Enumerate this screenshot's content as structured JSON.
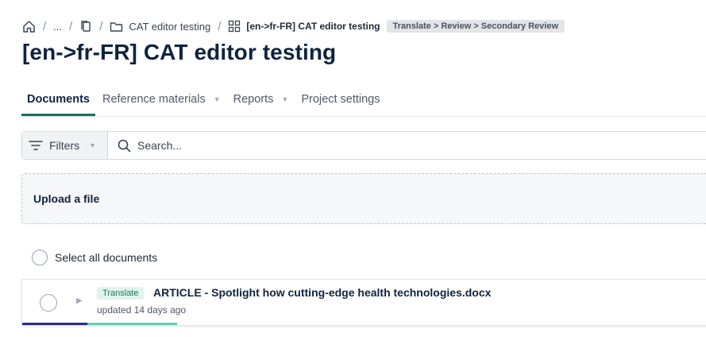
{
  "breadcrumb": {
    "ellipsis": "...",
    "separator": "/",
    "project": "CAT editor testing",
    "current": "[en->fr-FR] CAT editor testing",
    "workflow": "Translate > Review > Secondary Review"
  },
  "page": {
    "title": "[en->fr-FR] CAT editor testing"
  },
  "tabs": [
    {
      "label": "Documents",
      "active": true
    },
    {
      "label": "Reference materials",
      "has_dropdown": true
    },
    {
      "label": "Reports",
      "has_dropdown": true
    },
    {
      "label": "Project settings"
    }
  ],
  "filters": {
    "label": "Filters"
  },
  "search": {
    "placeholder": "Search...",
    "value": ""
  },
  "upload": {
    "label": "Upload a file"
  },
  "select_all": {
    "label": "Select all documents"
  },
  "documents": [
    {
      "status": "Translate",
      "name": "ARTICLE - Spotlight how cutting-edge health technologies.docx",
      "updated": "updated 14 days ago",
      "progress": [
        {
          "fraction": 0.095,
          "color": "#2b2b8f"
        },
        {
          "fraction": 0.13,
          "color": "#5ed3b3"
        }
      ]
    }
  ],
  "colors": {
    "accent": "#1c6e5a",
    "title": "#0f2340"
  },
  "icons": [
    "home-icon",
    "files-icon",
    "folder-icon",
    "grid-icon",
    "filter-icon",
    "search-icon",
    "caret-down-icon",
    "caret-right-icon"
  ]
}
